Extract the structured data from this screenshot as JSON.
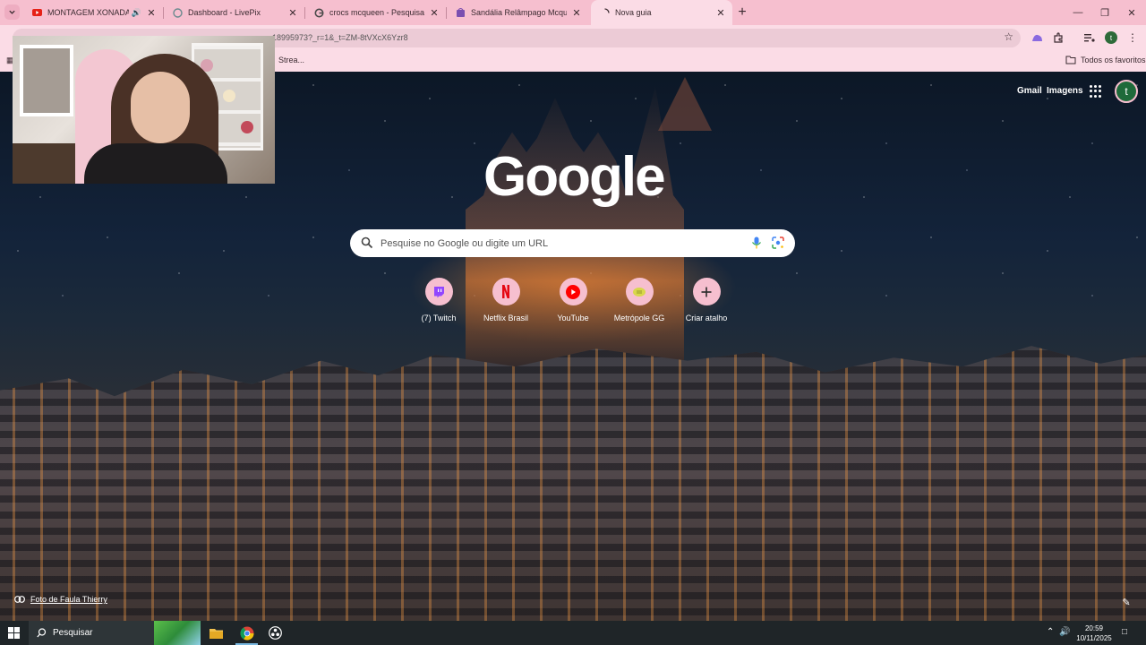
{
  "browser": {
    "tabs": [
      {
        "title": "MONTAGEM XONADA - Yo",
        "favicon": "youtube-icon",
        "audio": true,
        "active": false
      },
      {
        "title": "Dashboard - LivePix",
        "favicon": "livepix-icon",
        "active": false
      },
      {
        "title": "crocs mcqueen - Pesquisa Goo",
        "favicon": "google-icon",
        "active": false
      },
      {
        "title": "Sandália Relâmpago Mcqueen",
        "favicon": "shop-icon",
        "active": false
      },
      {
        "title": "Nova guia",
        "favicon": "loading-icon",
        "active": true
      }
    ],
    "new_tab_symbol": "+",
    "address_bar": {
      "url": "18995973?_r=1&_t=ZM-8tVXcX6Yzr8"
    },
    "profile_initial": "t",
    "bookmarks": {
      "item": "Strea...",
      "all_favorites": "Todos os favoritos"
    }
  },
  "ntp": {
    "logo": "Google",
    "links": {
      "gmail": "Gmail",
      "images": "Imagens"
    },
    "avatar_initial": "t",
    "search": {
      "placeholder": "Pesquise no Google ou digite um URL"
    },
    "shortcuts": [
      {
        "label": "(7) Twitch",
        "icon": "twitch-icon"
      },
      {
        "label": "Netflix Brasil",
        "icon": "netflix-icon"
      },
      {
        "label": "YouTube",
        "icon": "youtube-icon"
      },
      {
        "label": "Metrópole GG",
        "icon": "metropole-icon"
      },
      {
        "label": "Criar atalho",
        "icon": "plus-icon"
      }
    ],
    "photo_credit": "Foto de Faula Thierry"
  },
  "taskbar": {
    "search_label": "Pesquisar",
    "time": "20:59",
    "date": "10/11/2025"
  },
  "colors": {
    "chrome_pink": "#f6bfcf",
    "toolbar_pink": "#fbdce6",
    "taskbar": "#1f2528"
  }
}
